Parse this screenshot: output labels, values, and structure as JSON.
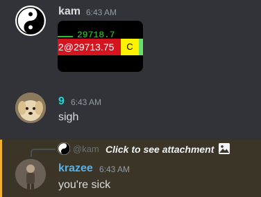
{
  "messages": [
    {
      "author": "kam",
      "timestamp": "6:43 AM",
      "attachment": {
        "green_text": "29718.7",
        "red_text": "2@29713.75",
        "yellow_text": "C"
      }
    },
    {
      "author": "9",
      "timestamp": "6:43 AM",
      "text": "sigh"
    },
    {
      "reply": {
        "name": "@kam",
        "cta": "Click to see attachment"
      },
      "author": "krazee",
      "timestamp": "6:43 AM",
      "text": "you're sick"
    }
  ],
  "colors": {
    "background": "#313338",
    "highlight": "#3a3527",
    "highlight_bar": "#f0b232",
    "author_9": "#1fd7d7",
    "author_krazee": "#5ab0e8"
  }
}
